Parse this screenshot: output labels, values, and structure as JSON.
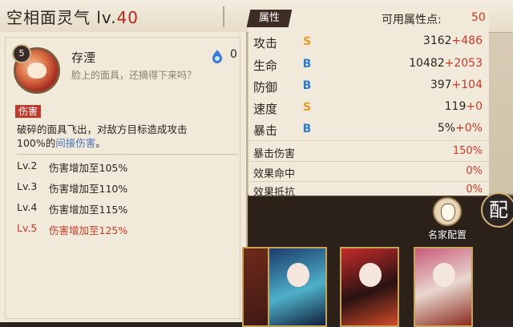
{
  "header": {
    "title": "空相面灵气",
    "level_prefix": "lv.",
    "level": "40"
  },
  "skill": {
    "badge": "5",
    "name": "存湮",
    "flavor": "脸上的面具，还摘得下来吗？",
    "orb_count": "0",
    "tag": "伤害",
    "effect_line1": "破碎的面具飞出，对敌方目标造成攻击",
    "effect_line2_a": "100%的",
    "effect_line2_b": "间接伤害",
    "effect_line2_c": "。",
    "levels": [
      {
        "lv": "Lv.2",
        "text": "伤害增加至105%",
        "current": false
      },
      {
        "lv": "Lv.3",
        "text": "伤害增加至110%",
        "current": false
      },
      {
        "lv": "Lv.4",
        "text": "伤害增加至115%",
        "current": false
      },
      {
        "lv": "Lv.5",
        "text": "伤害增加至125%",
        "current": true
      }
    ]
  },
  "attributes": {
    "tab": "属性",
    "points_label": "可用属性点:",
    "points_value": "50",
    "main": [
      {
        "name": "攻击",
        "grade": "S",
        "base": "3162",
        "bonus": "+486"
      },
      {
        "name": "生命",
        "grade": "B",
        "base": "10482",
        "bonus": "+2053"
      },
      {
        "name": "防御",
        "grade": "B",
        "base": "397",
        "bonus": "+104"
      },
      {
        "name": "速度",
        "grade": "S",
        "base": "119",
        "bonus": "+0"
      },
      {
        "name": "暴击",
        "grade": "B",
        "base": "5%",
        "bonus": "+0%"
      }
    ],
    "secondary": [
      {
        "name": "暴击伤害",
        "value": "150%"
      },
      {
        "name": "效果命中",
        "value": "0%"
      },
      {
        "name": "效果抵抗",
        "value": "0%"
      }
    ]
  },
  "buttons": {
    "mingjia": "名家配置",
    "pei": "配"
  },
  "colors": {
    "accent_red": "#c63a26",
    "grade_s": "#e79a22",
    "grade_b": "#2b7bd1",
    "link_blue": "#4a73b8"
  }
}
